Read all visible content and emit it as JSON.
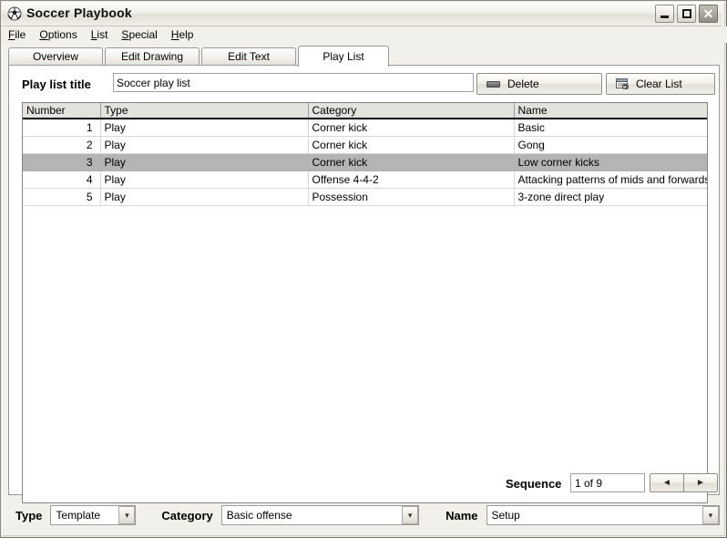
{
  "window": {
    "title": "Soccer Playbook",
    "icon": "soccer-ball-icon",
    "buttons": {
      "minimize": "minimize-icon",
      "maximize": "maximize-icon",
      "close": "✕"
    }
  },
  "menubar": {
    "items": [
      {
        "label": "File",
        "accel": "F"
      },
      {
        "label": "Options",
        "accel": "O"
      },
      {
        "label": "List",
        "accel": "L"
      },
      {
        "label": "Special",
        "accel": "S"
      },
      {
        "label": "Help",
        "accel": "H"
      }
    ]
  },
  "tabs": [
    {
      "label": "Overview",
      "active": false
    },
    {
      "label": "Edit Drawing",
      "active": false
    },
    {
      "label": "Edit Text",
      "active": false
    },
    {
      "label": "Play List",
      "active": true
    }
  ],
  "playlist": {
    "title_label": "Play list title",
    "title_value": "Soccer play list",
    "title_placeholder": "",
    "delete_button": "Delete",
    "delete_icon": "minus-bar-icon",
    "clear_button": "Clear List",
    "clear_icon": "clear-list-icon",
    "columns": [
      "Number",
      "Type",
      "Category",
      "Name"
    ],
    "rows": [
      {
        "number": "1",
        "type": "Play",
        "category": "Corner kick",
        "name": "Basic",
        "selected": false
      },
      {
        "number": "2",
        "type": "Play",
        "category": "Corner kick",
        "name": "Gong",
        "selected": false
      },
      {
        "number": "3",
        "type": "Play",
        "category": "Corner kick",
        "name": "Low corner kicks",
        "selected": true
      },
      {
        "number": "4",
        "type": "Play",
        "category": "Offense 4-4-2",
        "name": "Attacking patterns of mids and forwards",
        "selected": false
      },
      {
        "number": "5",
        "type": "Play",
        "category": "Possession",
        "name": "3-zone direct play",
        "selected": false
      }
    ]
  },
  "sequence": {
    "label": "Sequence",
    "value": "1 of 9",
    "prev_icon": "◄",
    "next_icon": "►"
  },
  "bottom": {
    "type_label": "Type",
    "type_value": "Template",
    "category_label": "Category",
    "category_value": "Basic offense",
    "name_label": "Name",
    "name_value": "Setup",
    "dropdown_icon": "chevron-down-icon"
  },
  "colors": {
    "selection": "#b4b4b4",
    "header": "#e4e2dc",
    "frame": "#f1f0ea"
  }
}
